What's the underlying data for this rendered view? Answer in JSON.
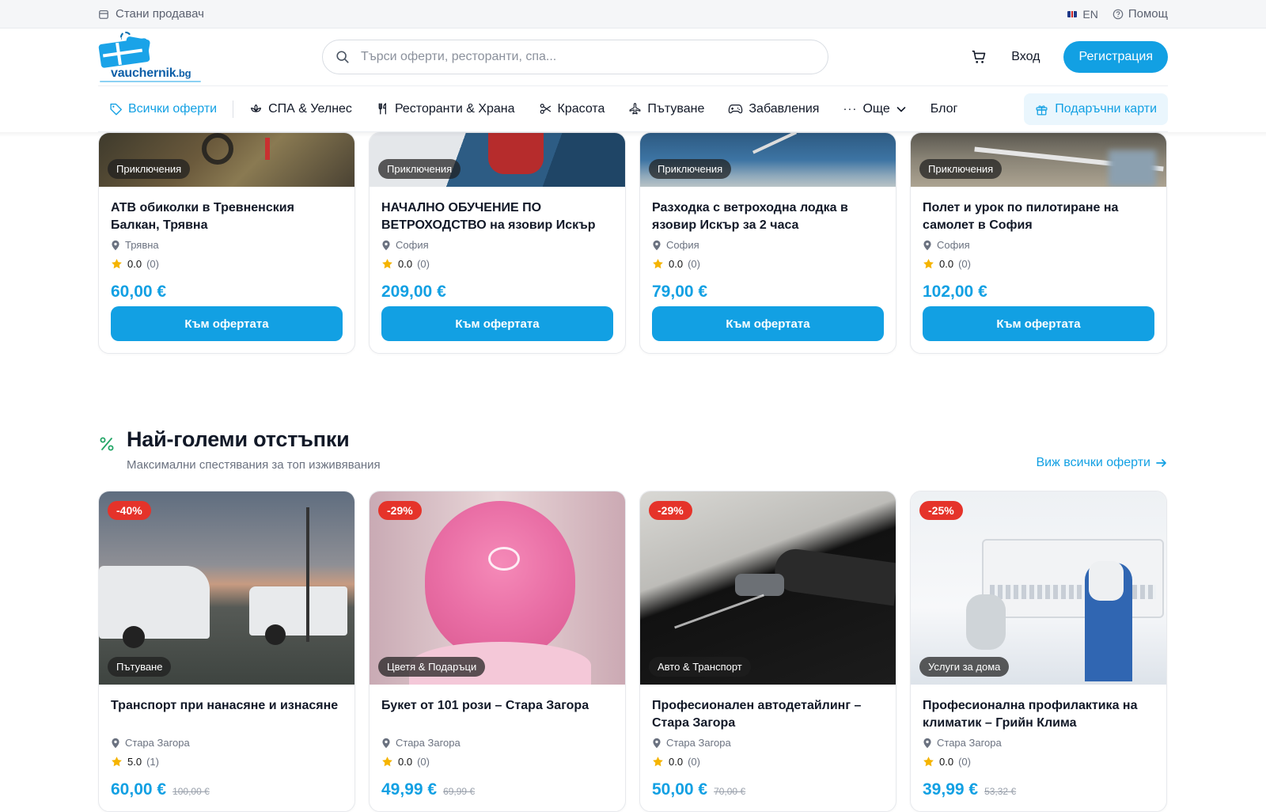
{
  "topbar": {
    "become_seller": "Стани продавач",
    "lang": "EN",
    "help": "Помощ"
  },
  "header": {
    "logo_text": "vauchernik",
    "logo_tld": ".bg",
    "search_placeholder": "Търси оферти, ресторанти, спа...",
    "login": "Вход",
    "register": "Регистрация"
  },
  "nav": {
    "all": "Всички оферти",
    "spa": "СПА & Уелнес",
    "restaurants": "Ресторанти & Храна",
    "beauty": "Красота",
    "travel": "Пътуване",
    "fun": "Забавления",
    "more": "Още",
    "blog": "Блог",
    "giftcards": "Подаръчни карти"
  },
  "top_cards": [
    {
      "category": "Приключения",
      "title": "АТВ обиколки в Тревненския Балкан, Трявна",
      "location": "Трявна",
      "rating": "0.0",
      "count": "(0)",
      "price": "60,00 €",
      "cta": "Към офертата"
    },
    {
      "category": "Приключения",
      "title": "НАЧАЛНО ОБУЧЕНИЕ ПО ВЕТРОХОДСТВО на язовир Искър",
      "location": "София",
      "rating": "0.0",
      "count": "(0)",
      "price": "209,00 €",
      "cta": "Към офертата"
    },
    {
      "category": "Приключения",
      "title": "Разходка с ветроходна лодка в язовир Искър за 2 часа",
      "location": "София",
      "rating": "0.0",
      "count": "(0)",
      "price": "79,00 €",
      "cta": "Към офертата"
    },
    {
      "category": "Приключения",
      "title": "Полет и урок по пилотиране на самолет в София",
      "location": "София",
      "rating": "0.0",
      "count": "(0)",
      "price": "102,00 €",
      "cta": "Към офертата"
    }
  ],
  "section": {
    "title": "Най-големи отстъпки",
    "subtitle": "Максимални спестявания за топ изживявания",
    "view_all": "Виж всички оферти"
  },
  "discount_cards": [
    {
      "discount": "-40%",
      "category": "Пътуване",
      "title": "Транспорт при нанасяне и изнасяне",
      "location": "Стара Загора",
      "rating": "5.0",
      "count": "(1)",
      "price": "60,00 €",
      "old_price": "100,00 €"
    },
    {
      "discount": "-29%",
      "category": "Цветя & Подаръци",
      "title": "Букет от 101 рози – Стара Загора",
      "location": "Стара Загора",
      "rating": "0.0",
      "count": "(0)",
      "price": "49,99 €",
      "old_price": "69,99 €"
    },
    {
      "discount": "-29%",
      "category": "Авто & Транспорт",
      "title": "Професионален автодетайлинг – Стара Загора",
      "location": "Стара Загора",
      "rating": "0.0",
      "count": "(0)",
      "price": "50,00 €",
      "old_price": "70,00 €"
    },
    {
      "discount": "-25%",
      "category": "Услуги за дома",
      "title": "Професионална профилактика на климатик – Грийн Клима",
      "location": "Стара Загора",
      "rating": "0.0",
      "count": "(0)",
      "price": "39,99 €",
      "old_price": "53,32 €"
    }
  ],
  "colors": {
    "accent": "#12a0e3",
    "discount": "#e5332a",
    "star": "#f5b400"
  }
}
